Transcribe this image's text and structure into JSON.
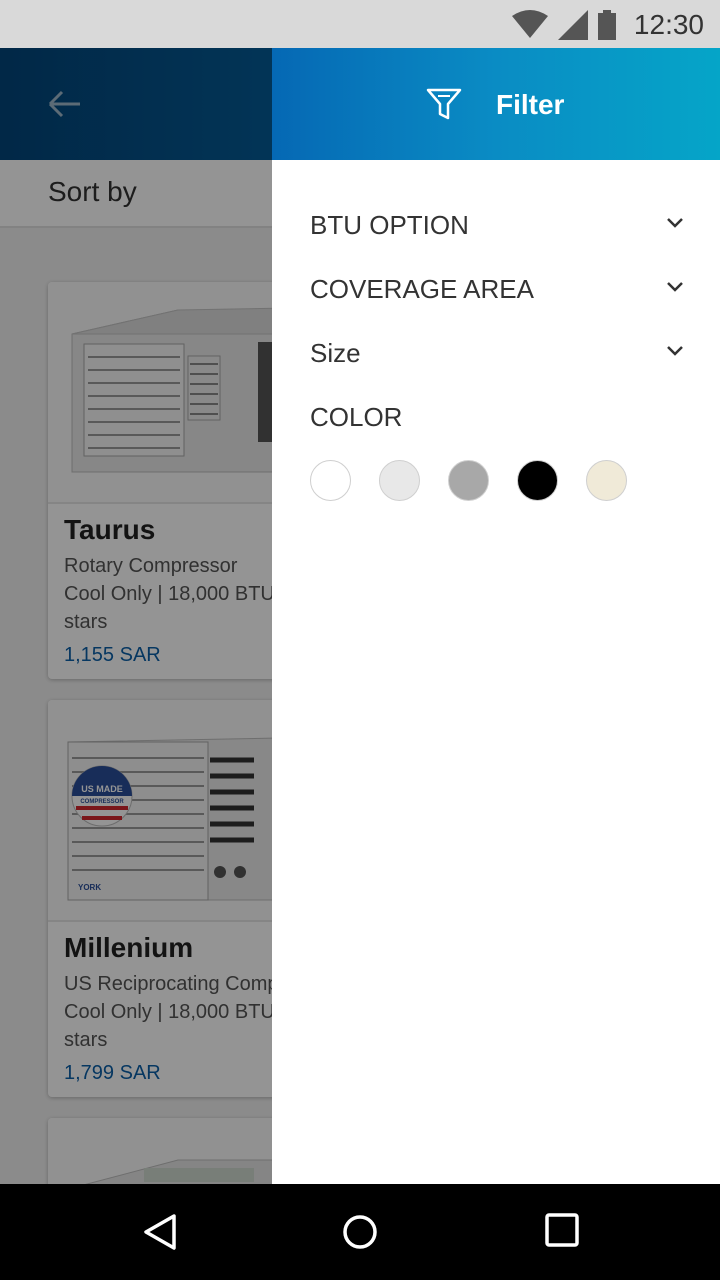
{
  "status_bar": {
    "time": "12:30",
    "icons": [
      "wifi-icon",
      "signal-icon",
      "battery-icon"
    ]
  },
  "app_bar": {
    "back_icon": "arrow-left-icon"
  },
  "sort": {
    "label": "Sort by"
  },
  "products": [
    {
      "name": "Taurus",
      "line1": "Rotary Compressor",
      "line2": "Cool Only | 18,000 BTU |",
      "line3": "stars",
      "price": "1,155 SAR"
    },
    {
      "name": "Millenium",
      "line1": "US Reciprocating Comp",
      "line2": "Cool Only | 18,000 BTU |",
      "line3": "stars",
      "price": "1,799 SAR",
      "badge_text": "US MADE COMPRESSOR",
      "brand_text": "YORK"
    }
  ],
  "drawer": {
    "title": "Filter",
    "icon": "filter-icon",
    "options": [
      {
        "label": "BTU OPTION"
      },
      {
        "label": "COVERAGE AREA"
      },
      {
        "label": "Size"
      }
    ],
    "color_label": "COLOR",
    "colors": [
      "#ffffff",
      "#e8e8e8",
      "#a8a8a8",
      "#000000",
      "#f0ead8"
    ]
  },
  "nav_bar": {
    "icons": [
      "back-triangle-icon",
      "home-circle-icon",
      "recents-square-icon"
    ]
  },
  "theme": {
    "accent": "#0568b4",
    "price_color": "#0b5fa8"
  }
}
